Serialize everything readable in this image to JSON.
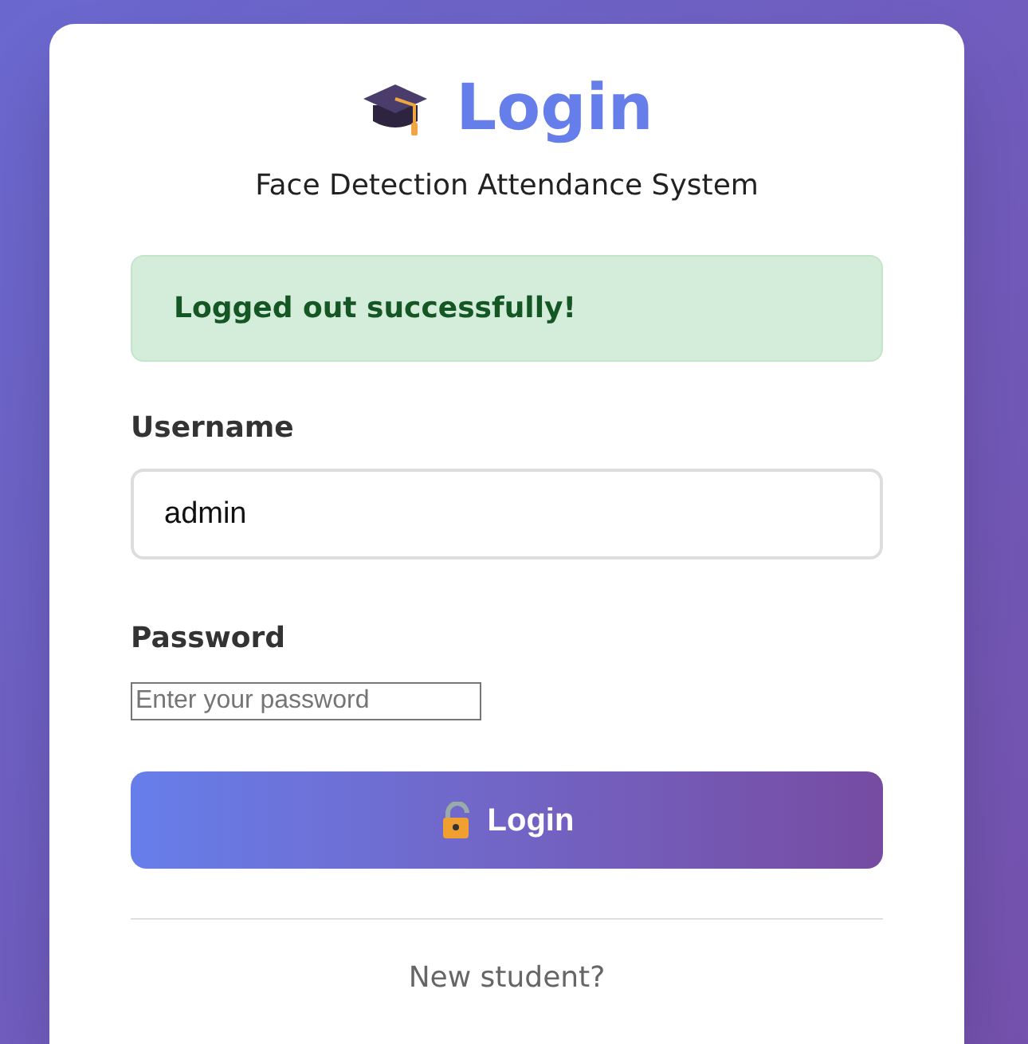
{
  "header": {
    "title": "Login",
    "subtitle": "Face Detection Attendance System"
  },
  "alert": {
    "kind": "success",
    "message": "Logged out successfully!"
  },
  "fields": [
    {
      "label": "Username",
      "value": "admin",
      "kind": "styled"
    },
    {
      "label": "Password",
      "placeholder": "Enter your password",
      "kind": "plain"
    }
  ],
  "submit": {
    "label": "Login"
  },
  "footer": {
    "text": "New student?"
  }
}
